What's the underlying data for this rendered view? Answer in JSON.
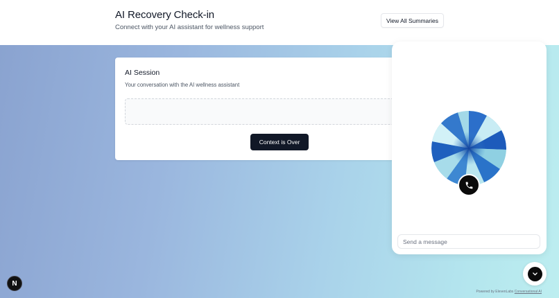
{
  "header": {
    "title": "AI Recovery Check-in",
    "subtitle": "Connect with your AI assistant for wellness support",
    "view_all_label": "View All Summaries"
  },
  "session": {
    "title": "AI Session",
    "description": "Your conversation with the AI wellness assistant",
    "context_button_label": "Context is Over"
  },
  "widget": {
    "message_placeholder": "Send a message",
    "powered_by_text": "Powered by ElevenLabs",
    "powered_by_link": "Conversational AI",
    "icons": {
      "orb": "voice-orb-icon",
      "call": "phone-icon",
      "collapse": "chevron-down-icon"
    }
  },
  "devtools": {
    "badge_label": "N"
  },
  "colors": {
    "primary_button": "#111827",
    "gradient_start": "#8aa3d0",
    "gradient_end": "#bdeef0",
    "orb_dark": "#1f5fbf",
    "orb_light": "#d6f0f8"
  }
}
